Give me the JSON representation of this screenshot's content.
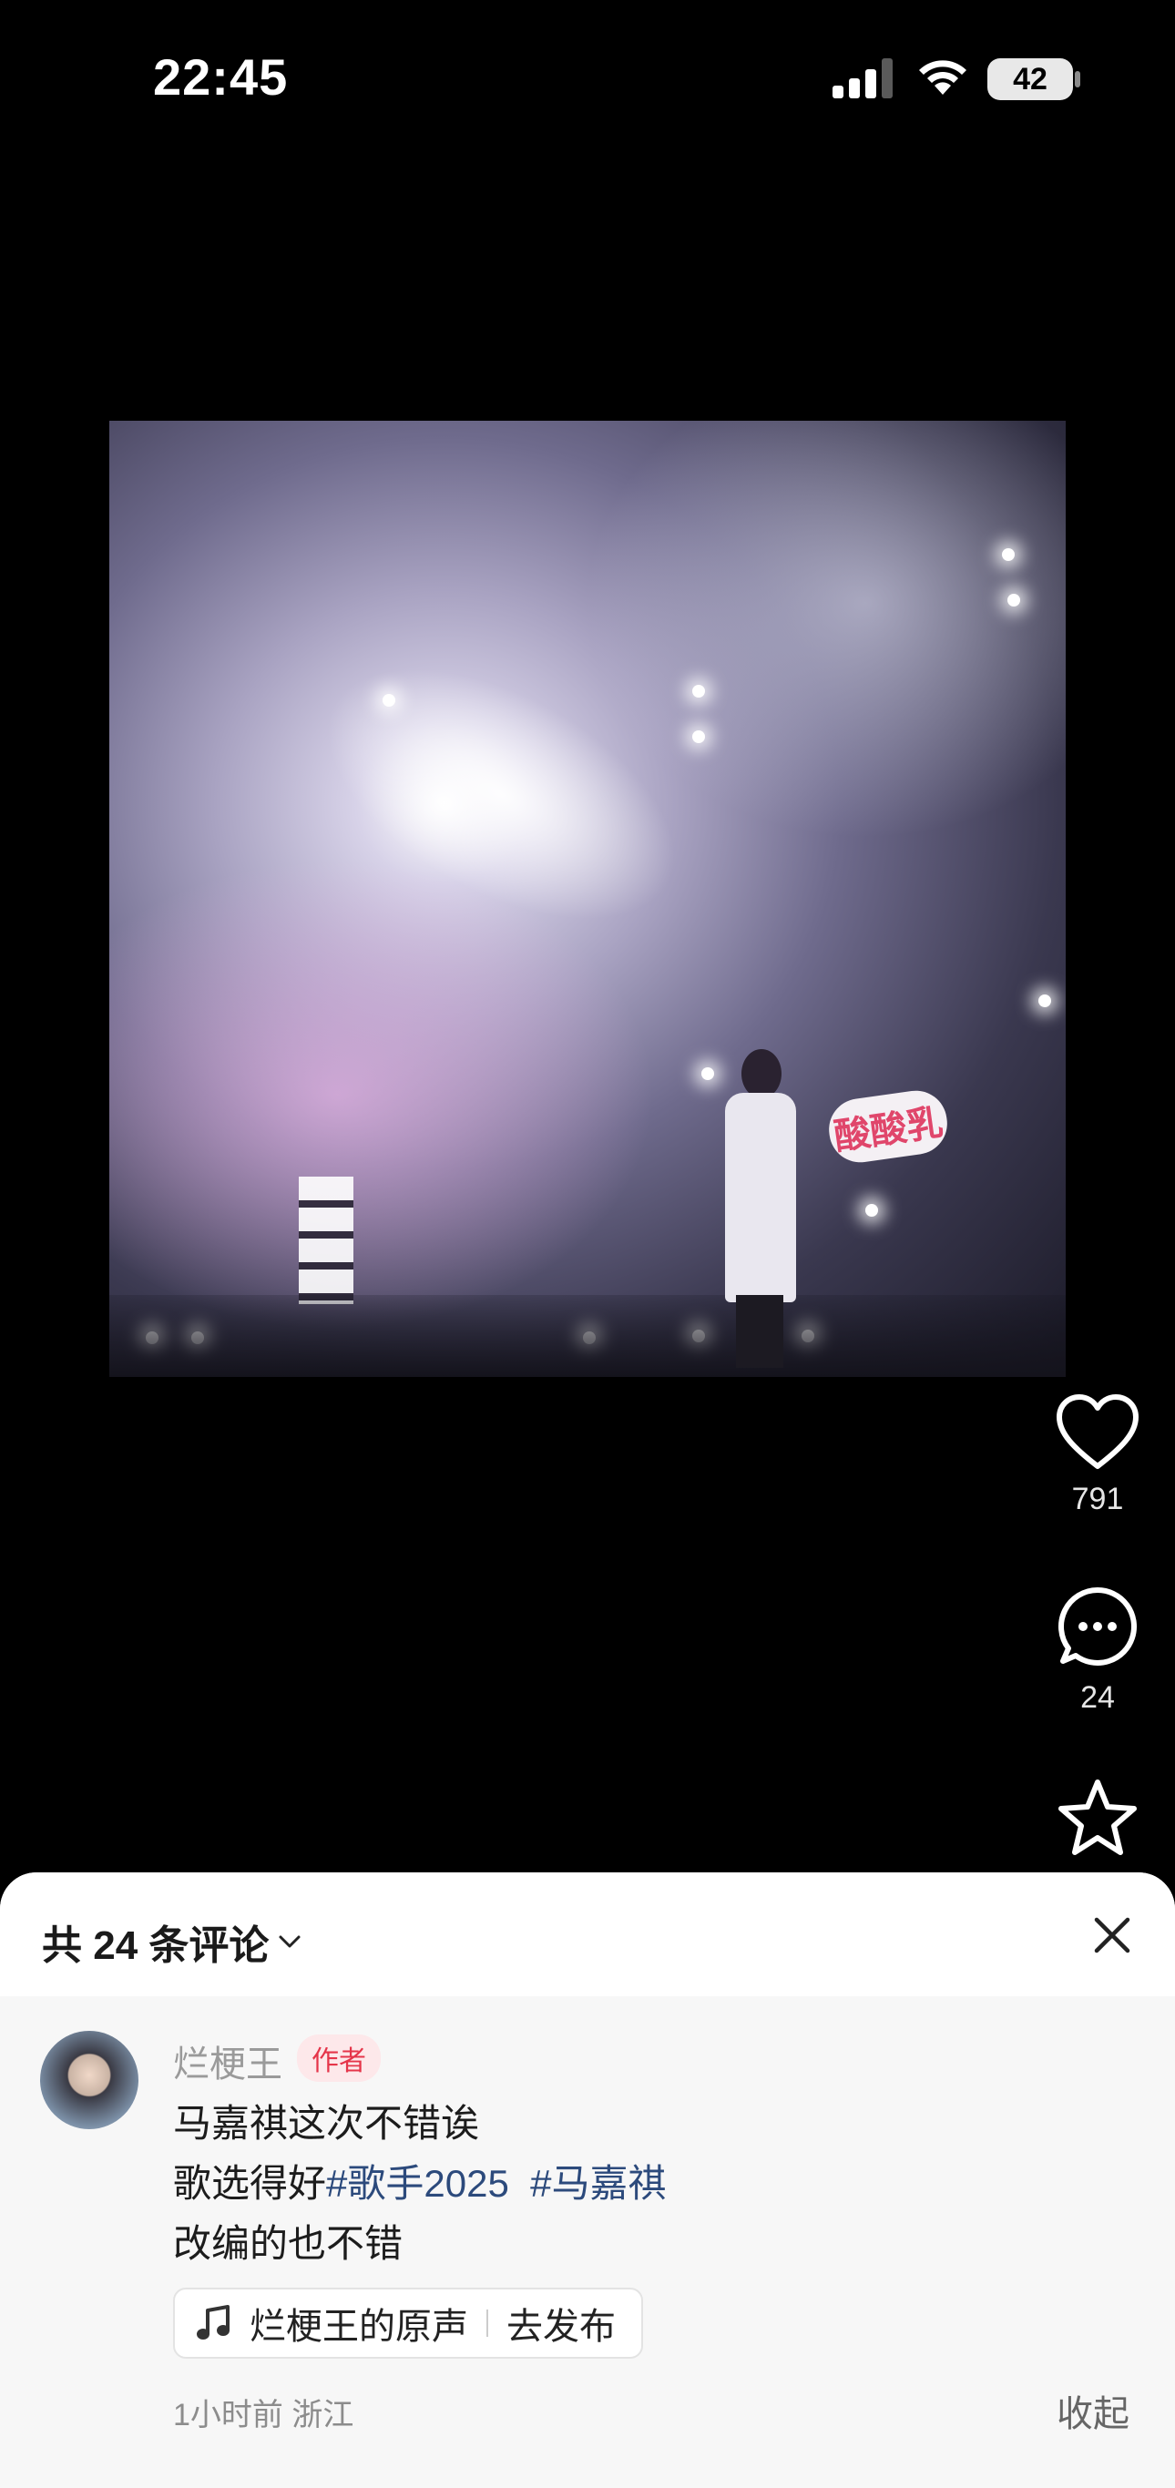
{
  "status_bar": {
    "time": "22:45",
    "battery": "42",
    "icons": [
      "signal-icon",
      "wifi-icon",
      "battery-icon"
    ]
  },
  "video": {
    "stage_sign": "酸酸乳"
  },
  "actions": {
    "like": {
      "icon": "heart-icon",
      "count": "791"
    },
    "comment": {
      "icon": "comment-bubble-icon",
      "count": "24"
    },
    "favorite": {
      "icon": "star-icon"
    }
  },
  "comments_sheet": {
    "title": "共 24 条评论",
    "title_icon": "chevron-down-icon",
    "close_icon": "close-icon",
    "comment": {
      "author": "烂梗王",
      "badge": "作者",
      "line1": "马嘉祺这次不错诶",
      "line2_text": "歌选得好",
      "line2_tag1": "#歌手2025",
      "line2_tag2": "#马嘉祺",
      "line3": "改编的也不错",
      "music": {
        "icon": "music-note-icon",
        "label": "烂梗王的原声",
        "action": "去发布"
      },
      "meta": "1小时前 浙江",
      "collapse": "收起"
    }
  }
}
